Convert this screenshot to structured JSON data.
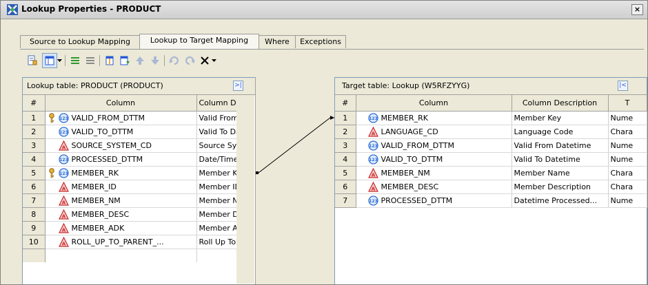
{
  "window": {
    "title": "Lookup Properties - PRODUCT",
    "close_label": "×"
  },
  "tabs": [
    {
      "label": "Source to Lookup Mapping",
      "active": false
    },
    {
      "label": "Lookup to Target Mapping",
      "active": true
    },
    {
      "label": "Where",
      "active": false
    },
    {
      "label": "Exceptions",
      "active": false
    }
  ],
  "toolbar": {
    "icons": [
      "properties-icon",
      "columns-dropdown-icon",
      "map-all-icon",
      "unmap-all-icon",
      "new-column-icon",
      "import-column-icon",
      "move-up-icon",
      "move-down-icon",
      "undo-icon",
      "redo-icon",
      "delete-icon"
    ]
  },
  "lookup_table": {
    "title": "Lookup table: PRODUCT (PRODUCT)",
    "headers": [
      "#",
      "Column",
      "Column De"
    ],
    "rows": [
      {
        "num": "1",
        "key": true,
        "type": "numeric",
        "column": "VALID_FROM_DTTM",
        "desc": "Valid From D"
      },
      {
        "num": "2",
        "key": false,
        "type": "numeric",
        "column": "VALID_TO_DTTM",
        "desc": "Valid To Dat"
      },
      {
        "num": "3",
        "key": false,
        "type": "character",
        "column": "SOURCE_SYSTEM_CD",
        "desc": "Source Syst"
      },
      {
        "num": "4",
        "key": false,
        "type": "numeric",
        "column": "PROCESSED_DTTM",
        "desc": "Date/Time F"
      },
      {
        "num": "5",
        "key": true,
        "type": "numeric",
        "column": "MEMBER_RK",
        "desc": "Member Key"
      },
      {
        "num": "6",
        "key": false,
        "type": "character",
        "column": "MEMBER_ID",
        "desc": "Member ID"
      },
      {
        "num": "7",
        "key": false,
        "type": "character",
        "column": "MEMBER_NM",
        "desc": "Member Nar"
      },
      {
        "num": "8",
        "key": false,
        "type": "character",
        "column": "MEMBER_DESC",
        "desc": "Member Des"
      },
      {
        "num": "9",
        "key": false,
        "type": "character",
        "column": "MEMBER_ADK",
        "desc": "Member AD"
      },
      {
        "num": "10",
        "key": false,
        "type": "character",
        "column": "ROLL_UP_TO_PARENT_...",
        "desc": "Roll Up To F"
      }
    ]
  },
  "target_table": {
    "title": "Target table: Lookup (W5RFZYYG)",
    "headers": [
      "#",
      "Column",
      "Column Description",
      "T"
    ],
    "rows": [
      {
        "num": "1",
        "type": "numeric",
        "column": "MEMBER_RK",
        "desc": "Member Key",
        "dtype": "Nume"
      },
      {
        "num": "2",
        "type": "character",
        "column": "LANGUAGE_CD",
        "desc": "Language Code",
        "dtype": "Chara"
      },
      {
        "num": "3",
        "type": "numeric",
        "column": "VALID_FROM_DTTM",
        "desc": "Valid From Datetime",
        "dtype": "Nume"
      },
      {
        "num": "4",
        "type": "numeric",
        "column": "VALID_TO_DTTM",
        "desc": "Valid To Datetime",
        "dtype": "Nume"
      },
      {
        "num": "5",
        "type": "character",
        "column": "MEMBER_NM",
        "desc": "Member Name",
        "dtype": "Chara"
      },
      {
        "num": "6",
        "type": "character",
        "column": "MEMBER_DESC",
        "desc": "Member Description",
        "dtype": "Chara"
      },
      {
        "num": "7",
        "type": "numeric",
        "column": "PROCESSED_DTTM",
        "desc": "Datetime Processed...",
        "dtype": "Nume"
      }
    ]
  },
  "mapping": {
    "from_row": 5,
    "to_row": 1
  }
}
